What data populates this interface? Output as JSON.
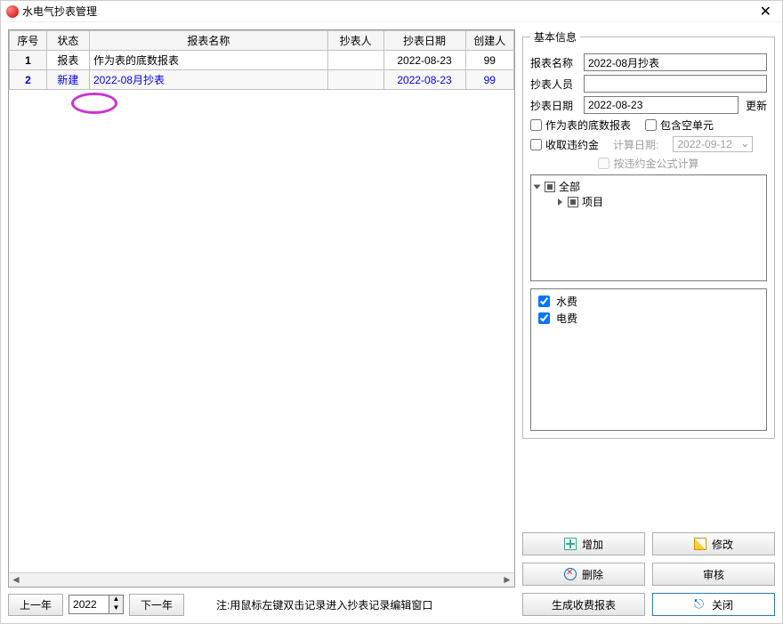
{
  "window": {
    "title": "水电气抄表管理"
  },
  "table": {
    "headers": {
      "num": "序号",
      "status": "状态",
      "name": "报表名称",
      "reader": "抄表人",
      "date": "抄表日期",
      "creator": "创建人"
    },
    "rows": [
      {
        "num": "1",
        "status": "报表",
        "name": "作为表的底数报表",
        "reader": "",
        "date": "2022-08-23",
        "creator": "99"
      },
      {
        "num": "2",
        "status": "新建",
        "name": "2022-08月抄表",
        "reader": "",
        "date": "2022-08-23",
        "creator": "99"
      }
    ]
  },
  "bottom": {
    "prev_year": "上一年",
    "year": "2022",
    "next_year": "下一年",
    "hint": "注:用鼠标左键双击记录进入抄表记录编辑窗口"
  },
  "panel": {
    "legend": "基本信息",
    "name_label": "报表名称",
    "name_value": "2022-08月抄表",
    "reader_label": "抄表人员",
    "reader_value": "",
    "date_label": "抄表日期",
    "date_value": "2022-08-23",
    "update": "更新",
    "chk_base": "作为表的底数报表",
    "chk_empty": "包含空单元",
    "chk_penalty": "收取违约金",
    "calc_date_label": "计算日期:",
    "calc_date_value": "2022-09-12",
    "chk_formula": "按违约金公式计算",
    "tree": {
      "root": "全部",
      "child": "项目"
    },
    "fees": [
      {
        "label": "水费",
        "checked": true
      },
      {
        "label": "电费",
        "checked": true
      }
    ]
  },
  "buttons": {
    "add": "增加",
    "edit": "修改",
    "del": "删除",
    "audit": "审核",
    "gen": "生成收费报表",
    "close": "关闭"
  }
}
